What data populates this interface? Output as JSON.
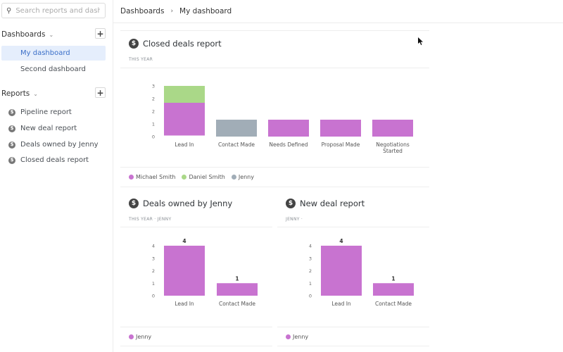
{
  "sidebar": {
    "search_placeholder": "Search reports and dashb...",
    "dashboards_label": "Dashboards",
    "dashboards": [
      {
        "label": "My dashboard",
        "active": true
      },
      {
        "label": "Second dashboard",
        "active": false
      }
    ],
    "reports_label": "Reports",
    "reports": [
      {
        "label": "Pipeline report"
      },
      {
        "label": "New deal report"
      },
      {
        "label": "Deals owned by Jenny"
      },
      {
        "label": "Closed deals report"
      }
    ],
    "add_symbol": "+",
    "chevron_symbol": "⌄",
    "dollar_symbol": "$"
  },
  "breadcrumb": {
    "root": "Dashboards",
    "separator": "›",
    "current": "My dashboard"
  },
  "colors": {
    "michael": "#c873d0",
    "daniel": "#aad888",
    "jenny_grey": "#a1adb7",
    "jenny_purple": "#c873d0",
    "active_nav": "#3b6fc8"
  },
  "cards": [
    {
      "title": "Closed deals report",
      "subtitle": "THIS YEAR"
    },
    {
      "title": "Deals owned by Jenny",
      "subtitle": "THIS YEAR  ·  JENNY"
    },
    {
      "title": "New deal report",
      "subtitle": "JENNY  ·"
    }
  ],
  "chart_data": [
    {
      "type": "bar",
      "stacked": true,
      "title": "Closed deals report",
      "categories": [
        "Lead In",
        "Contact Made",
        "Needs Defined",
        "Proposal Made",
        "Negotiations Started"
      ],
      "series": [
        {
          "name": "Michael Smith",
          "color": "#c873d0",
          "values": [
            2,
            0,
            1,
            1,
            1
          ]
        },
        {
          "name": "Daniel Smith",
          "color": "#aad888",
          "values": [
            1,
            0,
            0,
            0,
            0
          ]
        },
        {
          "name": "Jenny",
          "color": "#a1adb7",
          "values": [
            0,
            1,
            0,
            0,
            0
          ]
        }
      ],
      "yticks": [
        "0",
        "1",
        "2",
        "2",
        "3"
      ],
      "ylim": [
        0,
        3
      ],
      "legend": "bottom-left"
    },
    {
      "type": "bar",
      "title": "Deals owned by Jenny",
      "categories": [
        "Lead In",
        "Contact Made"
      ],
      "series": [
        {
          "name": "Jenny",
          "color": "#c873d0",
          "values": [
            4,
            1
          ]
        }
      ],
      "data_labels": [
        "4",
        "1"
      ],
      "yticks": [
        "0",
        "1",
        "2",
        "3",
        "4"
      ],
      "ylim": [
        0,
        4
      ],
      "legend": "bottom-left"
    },
    {
      "type": "bar",
      "title": "New deal report",
      "categories": [
        "Lead In",
        "Contact Made"
      ],
      "series": [
        {
          "name": "Jenny",
          "color": "#c873d0",
          "values": [
            4,
            1
          ]
        }
      ],
      "data_labels": [
        "4",
        "1"
      ],
      "yticks": [
        "0",
        "1",
        "2",
        "3",
        "4"
      ],
      "ylim": [
        0,
        4
      ],
      "legend": "bottom-left"
    }
  ]
}
